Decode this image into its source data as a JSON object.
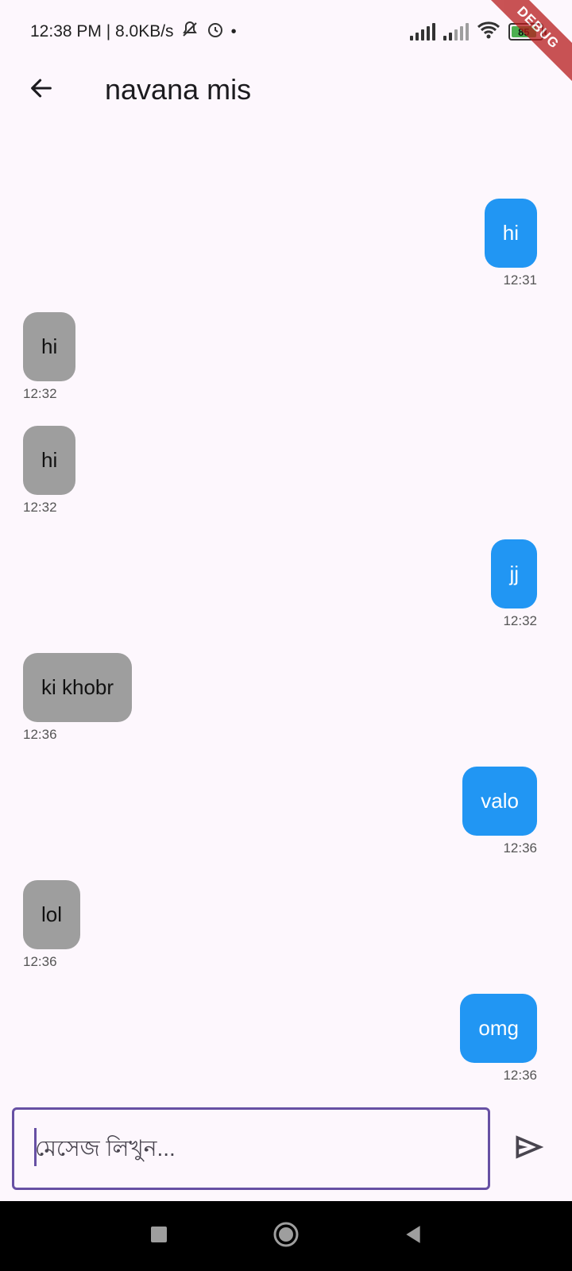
{
  "status_bar": {
    "time": "12:38 PM | 8.0KB/s",
    "battery": "85"
  },
  "debug_ribbon": "DEBUG",
  "app_bar": {
    "title": "navana mis"
  },
  "messages": [
    {
      "text": "hi",
      "time": "12:31",
      "direction": "sent"
    },
    {
      "text": "hi",
      "time": "12:32",
      "direction": "received"
    },
    {
      "text": "hi",
      "time": "12:32",
      "direction": "received"
    },
    {
      "text": "jj",
      "time": "12:32",
      "direction": "sent"
    },
    {
      "text": "ki khobr",
      "time": "12:36",
      "direction": "received"
    },
    {
      "text": "valo",
      "time": "12:36",
      "direction": "sent"
    },
    {
      "text": "lol",
      "time": "12:36",
      "direction": "received"
    },
    {
      "text": "omg",
      "time": "12:36",
      "direction": "sent"
    }
  ],
  "input": {
    "value": "",
    "placeholder": "মেসেজ লিখুন..."
  },
  "colors": {
    "sent_bubble": "#2196f3",
    "received_bubble": "#9e9e9e",
    "accent": "#6750a4",
    "background": "#fdf7fd"
  },
  "icons": {
    "back": "arrow-back-icon",
    "send": "send-icon",
    "nav_recents": "square-icon",
    "nav_home": "circle-icon",
    "nav_back": "triangle-back-icon"
  }
}
